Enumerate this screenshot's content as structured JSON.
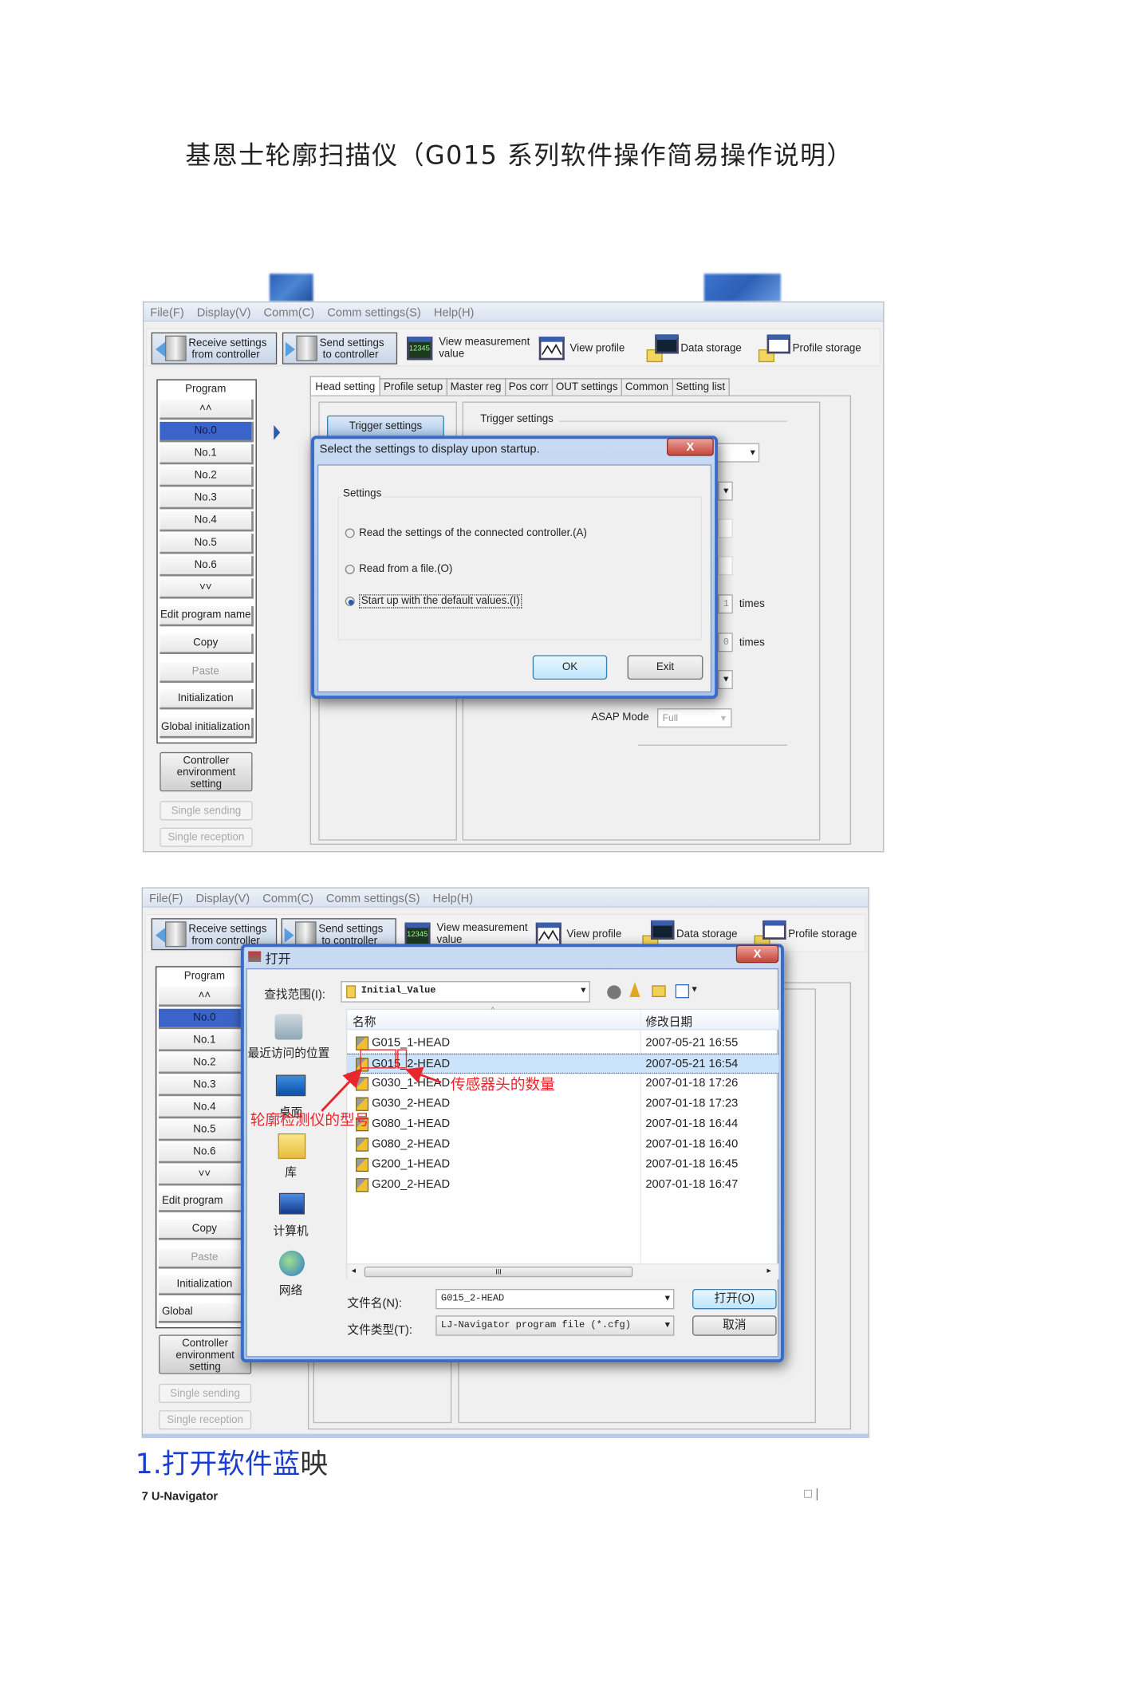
{
  "document": {
    "title": "基恩士轮廓扫描仪（G015 系列软件操作简易操作说明）",
    "caption_blue": "1.打开软件蓝",
    "caption_dark": "映",
    "footer_left": "7 U-Navigator",
    "footer_right": "□ |"
  },
  "app": {
    "menu": [
      "File(F)",
      "Display(V)",
      "Comm(C)",
      "Comm settings(S)",
      "Help(H)"
    ],
    "toolbar": {
      "receive_l1": "Receive settings",
      "receive_l2": "from controller",
      "send_l1": "Send settings",
      "send_l2": "to controller",
      "measure_icon_text": "12345",
      "measure_l1": "View measurement",
      "measure_l2": "value",
      "view_profile": "View profile",
      "data_storage": "Data storage",
      "profile_storage": "Profile storage"
    },
    "program": {
      "header": "Program",
      "up": "˄˄",
      "down": "˅˅",
      "items": [
        "No.0",
        "No.1",
        "No.2",
        "No.3",
        "No.4",
        "No.5",
        "No.6"
      ],
      "selected": "No.0",
      "edit_name": "Edit program name",
      "copy": "Copy",
      "paste": "Paste",
      "initialization": "Initialization",
      "global_initialization": "Global initialization"
    },
    "controller_env_l1": "Controller",
    "controller_env_l2": "environment",
    "controller_env_l3": "setting",
    "single_sending": "Single sending",
    "single_reception": "Single reception",
    "tabs": [
      "Head setting",
      "Profile setup",
      "Master reg",
      "Pos corr",
      "OUT settings",
      "Common",
      "Setting list"
    ],
    "active_tab": "Head setting",
    "trigger_button": "Trigger settings",
    "trigger_group": "Trigger settings",
    "count1": "1",
    "count0": "0",
    "times": "times",
    "asap_label": "ASAP Mode",
    "asap_value": "Full"
  },
  "startup_dialog": {
    "title": "Select the settings to display upon startup.",
    "close": "X",
    "group": "Settings",
    "options": [
      {
        "label": "Read the settings of the connected controller.(A)",
        "selected": false
      },
      {
        "label": "Read from a file.(O)",
        "selected": false
      },
      {
        "label": "Start up with the default values.(I)",
        "selected": true
      }
    ],
    "ok": "OK",
    "exit": "Exit"
  },
  "open_dialog": {
    "title": "打开",
    "close": "X",
    "look_in_label": "查找范围(I):",
    "look_in_value": "Initial_Value",
    "places": [
      "最近访问的位置",
      "桌面",
      "库",
      "计算机",
      "网络"
    ],
    "columns": [
      "名称",
      "修改日期"
    ],
    "files": [
      {
        "name": "G015_1-HEAD",
        "date": "2007-05-21 16:55"
      },
      {
        "name": "G015_2-HEAD",
        "date": "2007-05-21 16:54"
      },
      {
        "name": "G030_1-HEAD",
        "date": "2007-01-18 17:26"
      },
      {
        "name": "G030_2-HEAD",
        "date": "2007-01-18 17:23"
      },
      {
        "name": "G080_1-HEAD",
        "date": "2007-01-18 16:44"
      },
      {
        "name": "G080_2-HEAD",
        "date": "2007-01-18 16:40"
      },
      {
        "name": "G200_1-HEAD",
        "date": "2007-01-18 16:45"
      },
      {
        "name": "G200_2-HEAD",
        "date": "2007-01-18 16:47"
      }
    ],
    "selected_file": "G015_2-HEAD",
    "scroll_grip": "III",
    "filename_label": "文件名(N):",
    "filename_value": "G015_2-HEAD",
    "filetype_label": "文件类型(T):",
    "filetype_value": "LJ-Navigator program file (*.cfg)",
    "open_button": "打开(O)",
    "cancel_button": "取消"
  },
  "annotations": {
    "model": "轮廓检测仪的型号",
    "heads": "传感器头的数量",
    "color": "#e8262e"
  }
}
